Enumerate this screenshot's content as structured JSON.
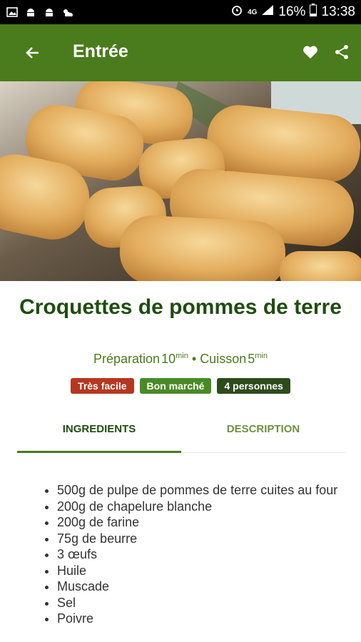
{
  "status_bar": {
    "icons_left": [
      "gallery-icon",
      "android-icon",
      "android-icon",
      "weather-icon"
    ],
    "icons_right": [
      "alarm-icon",
      "signal-4g-icon",
      "signal-bars-icon",
      "battery-icon"
    ],
    "network": "4G",
    "battery": "16%",
    "time": "13:38"
  },
  "app_bar": {
    "title": "Entrée",
    "color": "#4a7b1c"
  },
  "recipe": {
    "title": "Croquettes de pommes de terre",
    "prep_label": "Préparation",
    "prep_value": "10",
    "unit": "min",
    "separator": "•",
    "cook_label": "Cuisson",
    "cook_value": "5",
    "badges": [
      {
        "label": "Très facile",
        "color": "#b5371f"
      },
      {
        "label": "Bon marché",
        "color": "#4a8a25"
      },
      {
        "label": "4 personnes",
        "color": "#2e4b1c"
      }
    ]
  },
  "tabs": [
    {
      "label": "INGREDIENTS",
      "active": true
    },
    {
      "label": "DESCRIPTION",
      "active": false
    }
  ],
  "ingredients": [
    "500g de pulpe de pommes de terre cuites au four",
    "200g de chapelure blanche",
    "200g de farine",
    "75g de beurre",
    "3 œufs",
    "Huile",
    "Muscade",
    "Sel",
    "Poivre"
  ]
}
